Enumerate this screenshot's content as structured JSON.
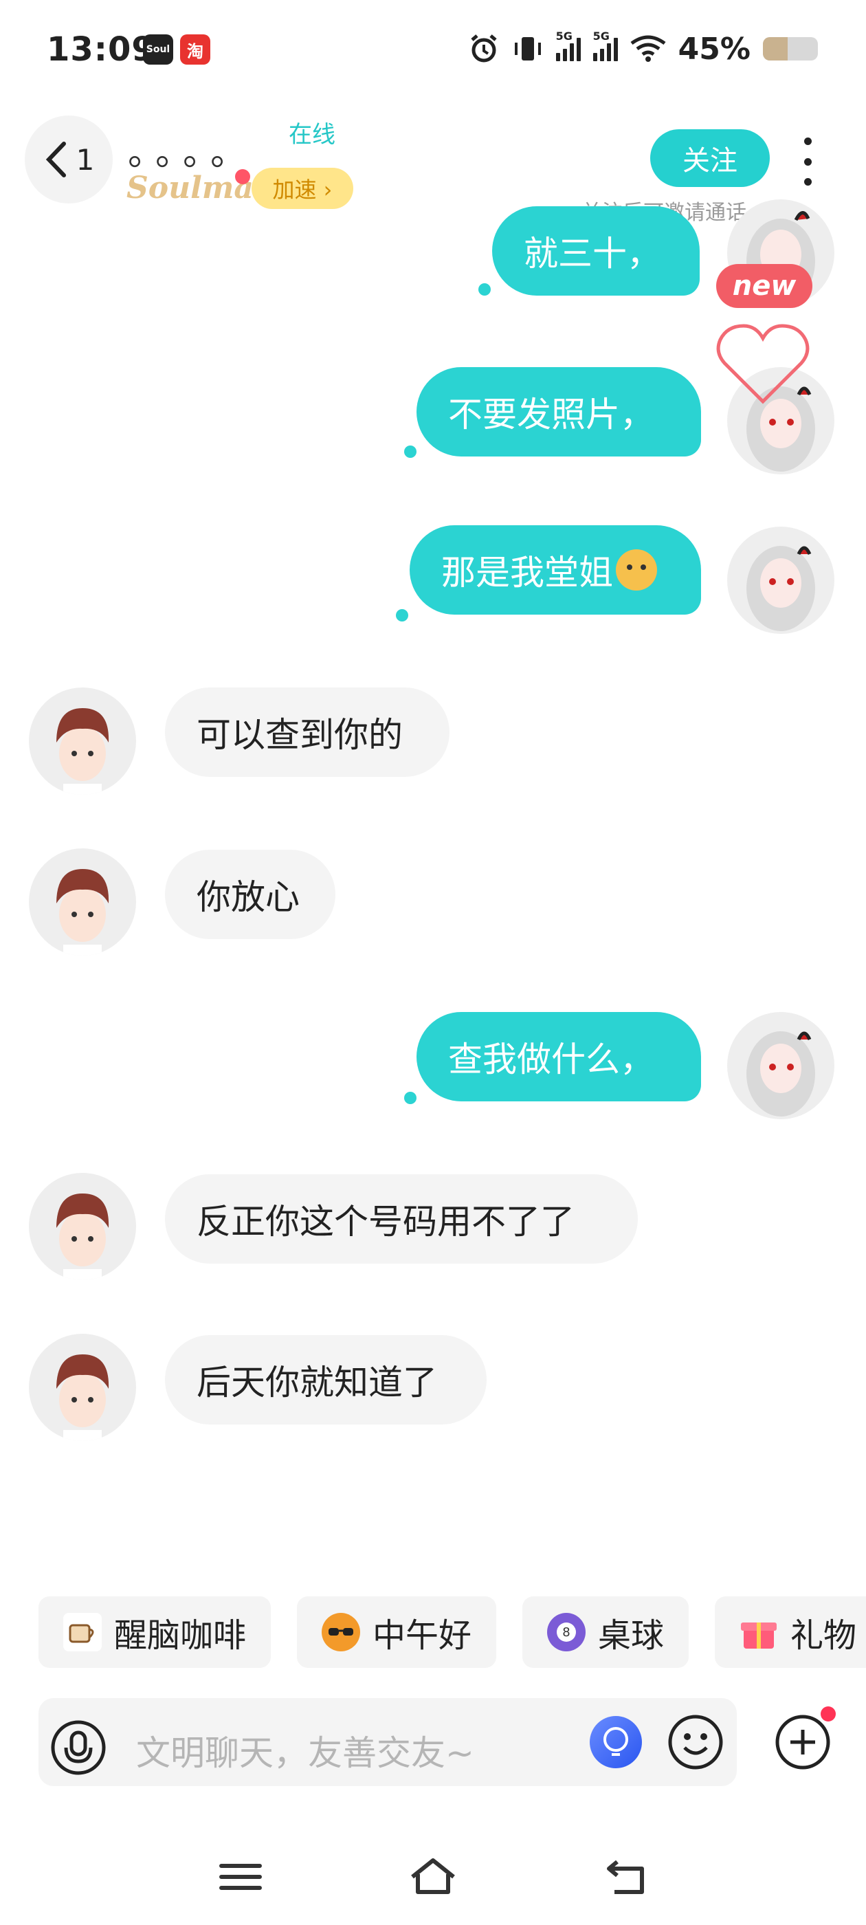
{
  "status_bar": {
    "time": "13:09",
    "app_badges": [
      "Soul",
      "淘"
    ],
    "network": [
      "5G",
      "5G"
    ],
    "battery_percent": "45%",
    "battery_level": 0.45
  },
  "header": {
    "back_count": "1",
    "nickname": "。。。。",
    "online_status": "在线",
    "soulmate_label": "Soulmate",
    "speed_button": "加速 ›",
    "follow_button": "关注",
    "follow_hint": "关注后可邀请通话"
  },
  "decorations": {
    "new_badge": "new"
  },
  "messages": [
    {
      "side": "right",
      "text": "就三十，"
    },
    {
      "side": "right",
      "text": "不要发照片，"
    },
    {
      "side": "right",
      "text": "那是我堂姐"
    },
    {
      "side": "left",
      "text": "可以查到你的"
    },
    {
      "side": "left",
      "text": "你放心"
    },
    {
      "side": "right",
      "text": "查我做什么，"
    },
    {
      "side": "left",
      "text": "反正你这个号码用不了了"
    },
    {
      "side": "left",
      "text": "后天你就知道了"
    }
  ],
  "quick_chips": [
    {
      "label": "醒脑咖啡",
      "icon": "coffee-icon"
    },
    {
      "label": "中午好",
      "icon": "sun-sunglasses-icon"
    },
    {
      "label": "桌球",
      "icon": "billiard-ball-icon"
    },
    {
      "label": "礼物",
      "icon": "gift-icon"
    }
  ],
  "input": {
    "placeholder": "文明聊天，友善交友~"
  },
  "colors": {
    "accent": "#2bd3d2",
    "speed_bg": "#ffe58a",
    "new_badge": "#f25d66"
  }
}
